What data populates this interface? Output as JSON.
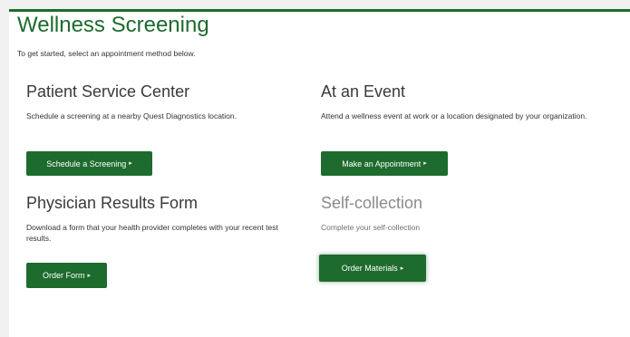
{
  "page": {
    "title": "Wellness Screening",
    "intro": "To get started, select an appointment method below."
  },
  "sections": {
    "patient_service_center": {
      "heading": "Patient Service Center",
      "description": "Schedule a screening at a nearby Quest Diagnostics location.",
      "button_label": "Schedule a Screening"
    },
    "at_an_event": {
      "heading": "At an Event",
      "description": "Attend a wellness event at work or a location designated by your organization.",
      "button_label": "Make an Appointment"
    },
    "physician_results_form": {
      "heading": "Physician Results Form",
      "description": "Download a form that your health provider completes with your recent test results.",
      "button_label": "Order Form"
    },
    "self_collection": {
      "heading": "Self-collection",
      "description": "Complete your self-collection",
      "button_label": "Order Materials"
    }
  },
  "icons": {
    "button_arrow": "caret-right-icon",
    "arrow_glyph": "▸"
  },
  "colors": {
    "brand_green": "#1e6b2e",
    "heading_gray": "#3a3a3a",
    "muted_gray": "#8a8a8a",
    "page_background": "#f1f1f1"
  }
}
